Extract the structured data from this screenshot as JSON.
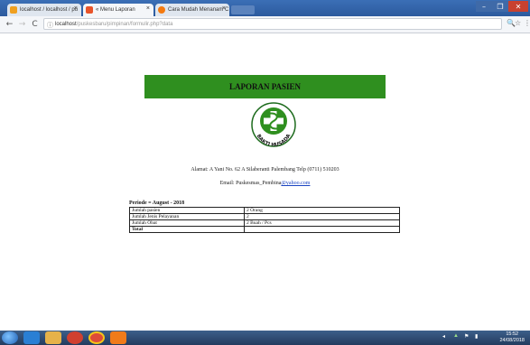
{
  "browser": {
    "tabs": [
      {
        "label": "localhost / localhost / pu",
        "close": "×",
        "color": "#f0a020"
      },
      {
        "label": "« Menu Laporan",
        "close": "×",
        "color": "#e8542a"
      },
      {
        "label": "Cara Mudah Menanam C",
        "close": "×",
        "color": "#f47a10"
      }
    ],
    "window_controls": {
      "minimize": "–",
      "maximize": "❐",
      "close": "✕"
    },
    "nav": {
      "back": "←",
      "forward": "→",
      "reload": "C"
    },
    "address": {
      "info_icon": "ⓘ",
      "host": "localhost",
      "path": "/puskesbaru/pimpinan/formulir.php?data"
    },
    "toolbar_icons": {
      "zoom": "🔍",
      "star": "☆",
      "menu": "⋮"
    }
  },
  "page": {
    "banner_title": "LAPORAN PASIEN",
    "logo_text": "BAKTI HUSADA",
    "address_line": "Alamat: A Yani No. 62 A Silaberanti Palembang Telp (0711) 510203",
    "email_label": "Email: ",
    "email_name": "Puskesmas_Pembina",
    "email_domain": "@yahoo.com",
    "period": "Periode = August - 2018",
    "table": [
      {
        "label": "Jumlah pasien",
        "value": "2 Orang"
      },
      {
        "label": "Jumlah Jenis Pelayanan",
        "value": "2"
      },
      {
        "label": "Jumlah Obat",
        "value": "2 Buah / Pcs"
      },
      {
        "label": "Total",
        "value": ""
      }
    ]
  },
  "taskbar": {
    "tray_icons": [
      "speaker",
      "network",
      "flag",
      "battery"
    ],
    "clock_time": "15:52",
    "clock_date": "24/08/2018",
    "colors": {
      "ie": "#2a7fd4",
      "folder": "#e6b24a",
      "media": "#d04030",
      "chrome": "#dd4b39",
      "xampp": "#f07b1a"
    }
  }
}
